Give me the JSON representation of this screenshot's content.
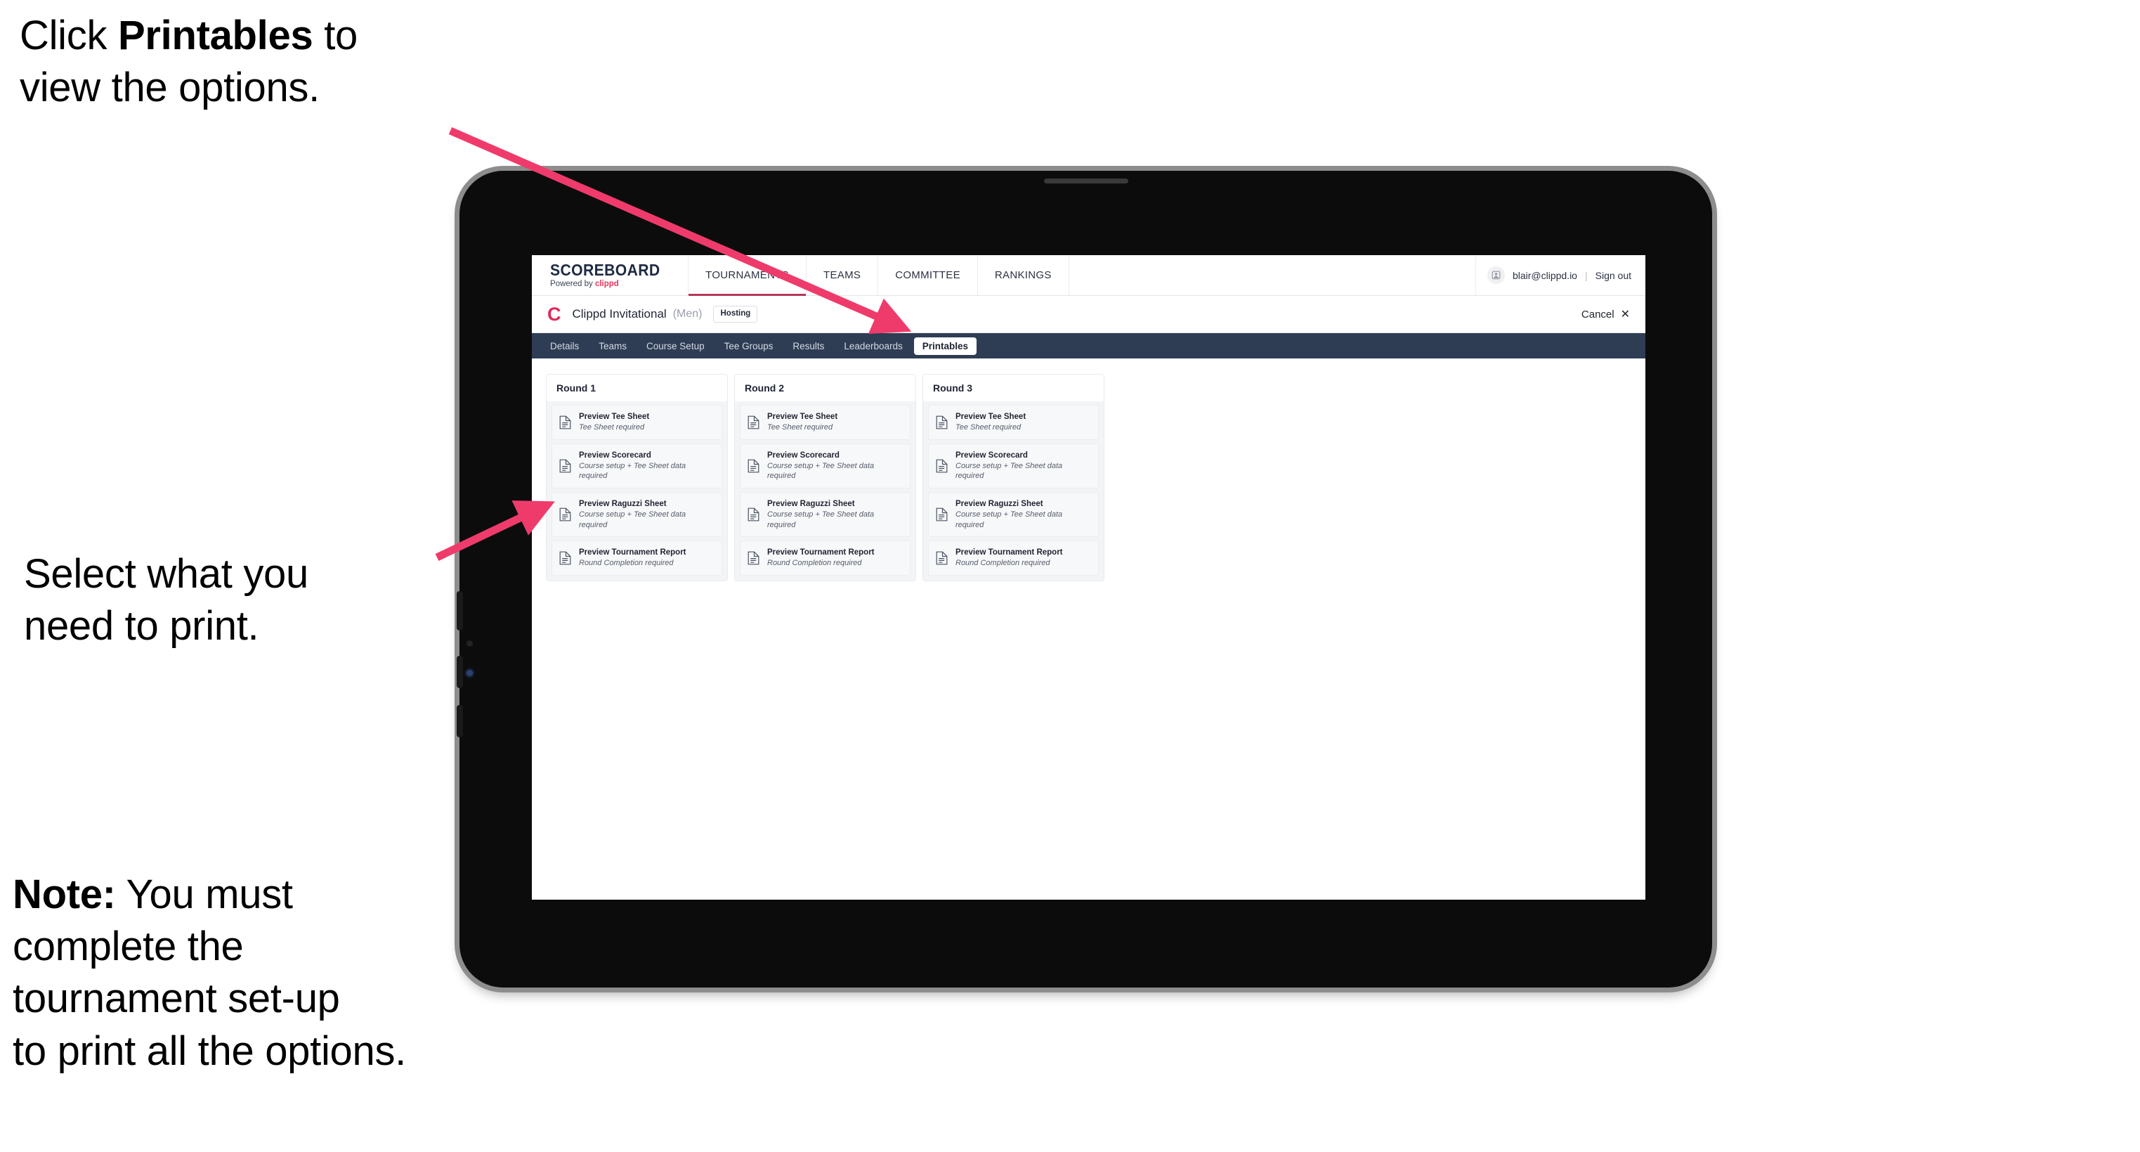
{
  "annotations": {
    "top": {
      "prefix": "Click ",
      "bold": "Printables",
      "suffix": " to\nview the options."
    },
    "middle": {
      "text": "Select what you\n need to print."
    },
    "note": {
      "bold": "Note:",
      "text": " You must\ncomplete the\ntournament set-up\nto print all the options."
    }
  },
  "app": {
    "brand": {
      "name": "SCOREBOARD",
      "powered_prefix": "Powered by ",
      "powered_brand": "clippd"
    },
    "nav": [
      {
        "label": "TOURNAMENTS",
        "active": true
      },
      {
        "label": "TEAMS",
        "active": false
      },
      {
        "label": "COMMITTEE",
        "active": false
      },
      {
        "label": "RANKINGS",
        "active": false
      }
    ],
    "user": {
      "avatar_icon": "user-avatar-icon",
      "email": "blair@clippd.io",
      "separator": "|",
      "signout_label": "Sign out"
    },
    "tournament": {
      "logo_letter": "C",
      "name": "Clippd Invitational",
      "gender": "(Men)",
      "status_badge": "Hosting",
      "cancel_label": "Cancel",
      "cancel_icon": "close-icon"
    },
    "tabs": [
      {
        "label": "Details",
        "active": false
      },
      {
        "label": "Teams",
        "active": false
      },
      {
        "label": "Course Setup",
        "active": false
      },
      {
        "label": "Tee Groups",
        "active": false
      },
      {
        "label": "Results",
        "active": false
      },
      {
        "label": "Leaderboards",
        "active": false
      },
      {
        "label": "Printables",
        "active": true
      }
    ],
    "rounds": [
      {
        "title": "Round 1",
        "items": [
          {
            "title": "Preview Tee Sheet",
            "sub": "Tee Sheet required",
            "icon": "document-icon"
          },
          {
            "title": "Preview Scorecard",
            "sub": "Course setup + Tee Sheet data required",
            "icon": "document-icon"
          },
          {
            "title": "Preview Raguzzi Sheet",
            "sub": "Course setup + Tee Sheet data required",
            "icon": "document-icon"
          },
          {
            "title": "Preview Tournament Report",
            "sub": "Round Completion required",
            "icon": "document-icon"
          }
        ]
      },
      {
        "title": "Round 2",
        "items": [
          {
            "title": "Preview Tee Sheet",
            "sub": "Tee Sheet required",
            "icon": "document-icon"
          },
          {
            "title": "Preview Scorecard",
            "sub": "Course setup + Tee Sheet data required",
            "icon": "document-icon"
          },
          {
            "title": "Preview Raguzzi Sheet",
            "sub": "Course setup + Tee Sheet data required",
            "icon": "document-icon"
          },
          {
            "title": "Preview Tournament Report",
            "sub": "Round Completion required",
            "icon": "document-icon"
          }
        ]
      },
      {
        "title": "Round 3",
        "items": [
          {
            "title": "Preview Tee Sheet",
            "sub": "Tee Sheet required",
            "icon": "document-icon"
          },
          {
            "title": "Preview Scorecard",
            "sub": "Course setup + Tee Sheet data required",
            "icon": "document-icon"
          },
          {
            "title": "Preview Raguzzi Sheet",
            "sub": "Course setup + Tee Sheet data required",
            "icon": "document-icon"
          },
          {
            "title": "Preview Tournament Report",
            "sub": "Round Completion required",
            "icon": "document-icon"
          }
        ]
      }
    ]
  },
  "colors": {
    "arrow": "#ef3b6b",
    "tabbar": "#2e3d54",
    "brand_pink": "#e8355f",
    "nav_underline": "#b8365a"
  }
}
